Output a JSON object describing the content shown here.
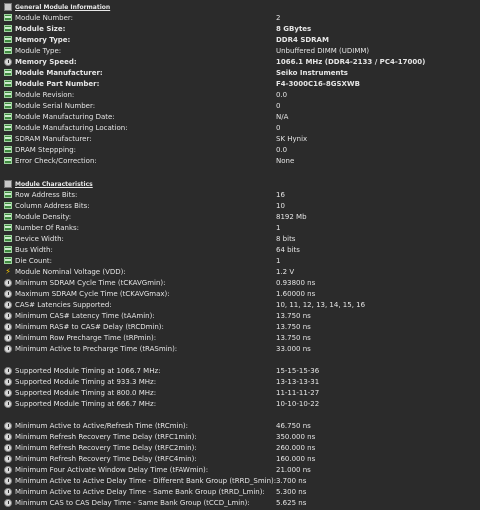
{
  "general": {
    "title": "General Module Information",
    "rows": [
      {
        "label": "Module Number:",
        "value": "2",
        "bold": false,
        "icon": "ram-icon"
      },
      {
        "label": "Module Size:",
        "value": "8 GBytes",
        "bold": true,
        "icon": "ram-icon"
      },
      {
        "label": "Memory Type:",
        "value": "DDR4 SDRAM",
        "bold": true,
        "icon": "ram-icon"
      },
      {
        "label": "Module Type:",
        "value": "Unbuffered DIMM (UDIMM)",
        "bold": false,
        "icon": "ram-icon"
      },
      {
        "label": "Memory Speed:",
        "value": "1066.1 MHz (DDR4-2133 / PC4-17000)",
        "bold": true,
        "icon": "clock-icon"
      },
      {
        "label": "Module Manufacturer:",
        "value": "Seiko Instruments",
        "bold": true,
        "icon": "ram-icon"
      },
      {
        "label": "Module Part Number:",
        "value": "F4-3000C16-8GSXWB",
        "bold": true,
        "icon": "ram-icon"
      },
      {
        "label": "Module Revision:",
        "value": "0.0",
        "bold": false,
        "icon": "ram-icon"
      },
      {
        "label": "Module Serial Number:",
        "value": "0",
        "bold": false,
        "icon": "ram-icon"
      },
      {
        "label": "Module Manufacturing Date:",
        "value": "N/A",
        "bold": false,
        "icon": "ram-icon"
      },
      {
        "label": "Module Manufacturing Location:",
        "value": "0",
        "bold": false,
        "icon": "ram-icon"
      },
      {
        "label": "SDRAM Manufacturer:",
        "value": "SK Hynix",
        "bold": false,
        "icon": "ram-icon"
      },
      {
        "label": "DRAM Steppping:",
        "value": "0.0",
        "bold": false,
        "icon": "ram-icon"
      },
      {
        "label": "Error Check/Correction:",
        "value": "None",
        "bold": false,
        "icon": "ram-icon"
      }
    ]
  },
  "characteristics": {
    "title": "Module Characteristics",
    "rows": [
      {
        "label": "Row Address Bits:",
        "value": "16",
        "icon": "ram-icon"
      },
      {
        "label": "Column Address Bits:",
        "value": "10",
        "icon": "ram-icon"
      },
      {
        "label": "Module Density:",
        "value": "8192 Mb",
        "icon": "ram-icon"
      },
      {
        "label": "Number Of Ranks:",
        "value": "1",
        "icon": "ram-icon"
      },
      {
        "label": "Device Width:",
        "value": "8 bits",
        "icon": "ram-icon"
      },
      {
        "label": "Bus Width:",
        "value": "64 bits",
        "icon": "ram-icon"
      },
      {
        "label": "Die Count:",
        "value": "1",
        "icon": "ram-icon"
      },
      {
        "label": "Module Nominal Voltage (VDD):",
        "value": "1.2 V",
        "icon": "bolt-icon"
      },
      {
        "label": "Minimum SDRAM Cycle Time (tCKAVGmin):",
        "value": "0.93800 ns",
        "icon": "clock-icon"
      },
      {
        "label": "Maximum SDRAM Cycle Time (tCKAVGmax):",
        "value": "1.60000 ns",
        "icon": "clock-icon"
      },
      {
        "label": "CAS# Latencies Supported:",
        "value": "10, 11, 12, 13, 14, 15, 16",
        "icon": "clock-icon"
      },
      {
        "label": "Minimum CAS# Latency Time (tAAmin):",
        "value": "13.750 ns",
        "icon": "clock-icon"
      },
      {
        "label": "Minimum RAS# to CAS# Delay (tRCDmin):",
        "value": "13.750 ns",
        "icon": "clock-icon"
      },
      {
        "label": "Minimum Row Precharge Time (tRPmin):",
        "value": "13.750 ns",
        "icon": "clock-icon"
      },
      {
        "label": "Minimum Active to Precharge Time (tRASmin):",
        "value": "33.000 ns",
        "icon": "clock-icon"
      }
    ],
    "timings": [
      {
        "label": "Supported Module Timing at 1066.7 MHz:",
        "value": "15-15-15-36",
        "icon": "clock-icon"
      },
      {
        "label": "Supported Module Timing at 933.3 MHz:",
        "value": "13-13-13-31",
        "icon": "clock-icon"
      },
      {
        "label": "Supported Module Timing at 800.0 MHz:",
        "value": "11-11-11-27",
        "icon": "clock-icon"
      },
      {
        "label": "Supported Module Timing at 666.7 MHz:",
        "value": "10-10-10-22",
        "icon": "clock-icon"
      }
    ],
    "delays": [
      {
        "label": "Minimum Active to Active/Refresh Time (tRCmin):",
        "value": "46.750 ns",
        "icon": "clock-icon"
      },
      {
        "label": "Minimum Refresh Recovery Time Delay (tRFC1min):",
        "value": "350.000 ns",
        "icon": "clock-icon"
      },
      {
        "label": "Minimum Refresh Recovery Time Delay (tRFC2min):",
        "value": "260.000 ns",
        "icon": "clock-icon"
      },
      {
        "label": "Minimum Refresh Recovery Time Delay (tRFC4min):",
        "value": "160.000 ns",
        "icon": "clock-icon"
      },
      {
        "label": "Minimum Four Activate Window Delay Time (tFAWmin):",
        "value": "21.000 ns",
        "icon": "clock-icon"
      },
      {
        "label": "Minimum Active to Active Delay Time - Different Bank Group (tRRD_Smin):",
        "value": "3.700 ns",
        "icon": "clock-icon"
      },
      {
        "label": "Minimum Active to Active Delay Time - Same Bank Group (tRRD_Lmin):",
        "value": "5.300 ns",
        "icon": "clock-icon"
      },
      {
        "label": "Minimum CAS to CAS Delay Time - Same Bank Group (tCCD_Lmin):",
        "value": "5.625 ns",
        "icon": "clock-icon"
      }
    ]
  }
}
